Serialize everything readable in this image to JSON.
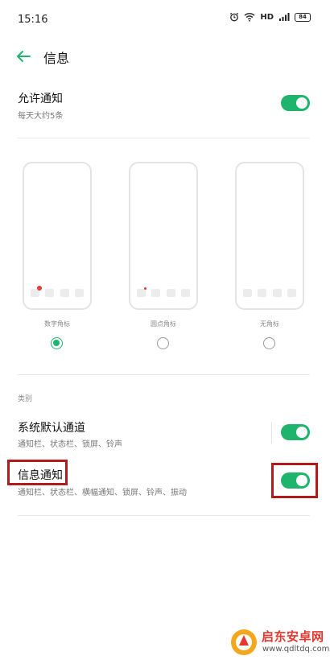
{
  "status_bar": {
    "time": "15:16",
    "network": "HD",
    "battery": "84"
  },
  "header": {
    "title": "信息"
  },
  "allow_notifications": {
    "title": "允许通知",
    "subtitle": "每天大约5条",
    "enabled": true
  },
  "badge_styles": {
    "options": [
      {
        "label": "数字角标",
        "selected": true
      },
      {
        "label": "圆点角标",
        "selected": false
      },
      {
        "label": "无角标",
        "selected": false
      }
    ]
  },
  "categories": {
    "label": "类别",
    "items": [
      {
        "title": "系统默认通道",
        "subtitle": "通知栏、状态栏、锁屏、铃声",
        "enabled": true
      },
      {
        "title": "信息通知",
        "subtitle": "通知栏、状态栏、横幅通知、锁屏、铃声、振动",
        "enabled": true
      }
    ]
  },
  "watermark": {
    "title": "启东安卓网",
    "url": "www.qdltdq.com"
  },
  "colors": {
    "accent": "#1fb46c",
    "badge": "#e83b3b",
    "highlight": "#b31b1b"
  }
}
